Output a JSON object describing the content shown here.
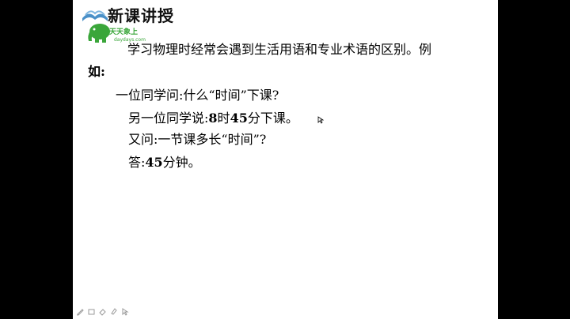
{
  "header": {
    "title": "新课讲授",
    "logo_text": "天天象上",
    "logo_url": "daydays.com"
  },
  "content": {
    "intro_line1": "学习物理时经常会遇到生活用语和专业术语的区别。例",
    "intro_line2": "如:",
    "question1": "一位同学问:什么“时间”下课?",
    "answer1_prefix": "另一位同学说:",
    "answer1_num1": "8",
    "answer1_mid": "时",
    "answer1_num2": "45",
    "answer1_suffix": "分下课。",
    "question2": "又问:一节课多长“时间”?",
    "answer2_prefix": "答:",
    "answer2_num": "45",
    "answer2_suffix": "分钟。"
  },
  "toolbar": {
    "icons": [
      "pen-icon",
      "pointer-icon",
      "eraser-icon",
      "highlighter-icon",
      "arrow-icon"
    ]
  },
  "colors": {
    "logo_green": "#3aa63a",
    "logo_blue": "#4a90c8",
    "slide_bg": "#ffffff",
    "frame_bg": "#000000"
  }
}
